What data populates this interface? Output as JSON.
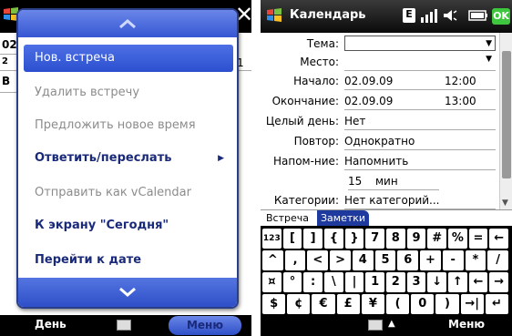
{
  "left": {
    "menu_items": [
      {
        "label": "Нов. встреча",
        "enabled": true,
        "selected": true
      },
      {
        "label": "Удалить встречу",
        "enabled": false
      },
      {
        "label": "Предложить новое время",
        "enabled": false
      },
      {
        "label": "Ответить/переслать",
        "enabled": true,
        "submenu": true
      },
      {
        "label": "Отправить как  vCalendar",
        "enabled": false
      },
      {
        "label": "К экрану \"Сегодня\"",
        "enabled": true
      },
      {
        "label": "Перейти к дате",
        "enabled": true
      }
    ],
    "bg_strip": [
      "02",
      "2",
      "В"
    ],
    "bg_right": [
      "1"
    ],
    "softkey_left": "День",
    "softkey_right": "Меню",
    "icons": {
      "start": "windows-flag-icon",
      "close": "close-icon",
      "up": "chevron-up-icon",
      "down": "chevron-down-icon",
      "keyboard": "keyboard-icon",
      "submenu": "triangle-right-icon"
    }
  },
  "right": {
    "title": "Календарь",
    "status": {
      "badge": "E",
      "ok": "OK"
    },
    "fields": [
      {
        "label": "Тема:",
        "value": "",
        "type": "dropdown"
      },
      {
        "label": "Место:",
        "value": "",
        "type": "dropdown"
      },
      {
        "label": "Начало:",
        "value": "02.09.09",
        "value2": "12:00"
      },
      {
        "label": "Окончание:",
        "value": "02.09.09",
        "value2": "13:00"
      },
      {
        "label": "Целый день:",
        "value": "Нет"
      },
      {
        "label": "Повтор:",
        "value": "Однократно"
      },
      {
        "label": "Напом-ние:",
        "value": "Напомнить"
      },
      {
        "label": "",
        "value": "15",
        "value2": "мин"
      },
      {
        "label": "Категории:",
        "value": "Нет категорий..."
      }
    ],
    "tabs": [
      "Встреча",
      "Заметки"
    ],
    "active_tab": 1,
    "keyboard_rows": [
      [
        "123",
        "[",
        "]",
        "{",
        "}",
        "7",
        "8",
        "9",
        "#",
        "%",
        "=",
        "←"
      ],
      [
        "^",
        ",",
        "<",
        ">",
        "4",
        "5",
        "6",
        "+",
        "-",
        "*",
        "/"
      ],
      [
        "¤",
        "°",
        ":",
        "\\",
        "|",
        "1",
        "2",
        "3",
        "↓",
        "↑",
        "←",
        "→"
      ],
      [
        "$",
        "¢",
        "€",
        "£",
        "¥",
        "(",
        "0",
        ")",
        "→|",
        "↵"
      ]
    ],
    "softkey_right": "Меню",
    "icons": {
      "start": "windows-flag-icon",
      "signal": "signal-icon",
      "volume": "volume-icon",
      "battery": "battery-icon",
      "keyboard": "keyboard-icon"
    }
  },
  "colors": {
    "menu_blue": "#3657d3",
    "menu_text": "#1a2a7a",
    "disabled": "#8c8c8c",
    "ok_green": "#3ec63e",
    "tab_blue": "#1f3a9e"
  }
}
